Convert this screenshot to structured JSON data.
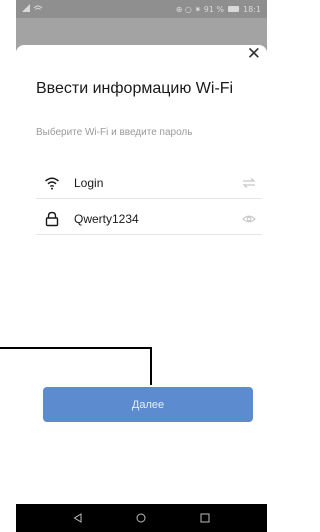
{
  "status_bar": {
    "right_text": "⊕ ○ ✷ 91 %",
    "time": "18:1"
  },
  "dialog": {
    "title": "Ввести информацию Wi-Fi",
    "subtitle": "Выберите Wi-Fi и введите пароль",
    "ssid": {
      "value": "Login",
      "icon": "wifi-icon",
      "trailing_icon": "switch-icon"
    },
    "password": {
      "value": "Qwerty1234",
      "icon": "lock-icon",
      "trailing_icon": "eye-icon"
    },
    "next_label": "Далее",
    "close_icon": "close-icon"
  },
  "colors": {
    "accent": "#5c8ccf",
    "overlay": "#8f8f8f",
    "nav_bar": "#000000"
  },
  "nav_bar": {
    "icons": [
      "back-icon",
      "home-icon",
      "recents-icon"
    ]
  }
}
